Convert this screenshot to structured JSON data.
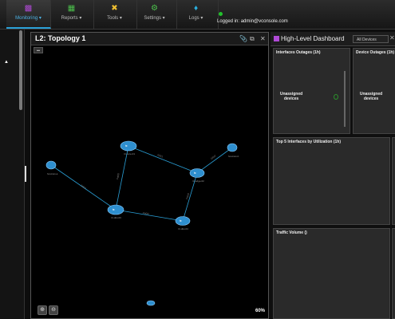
{
  "nav": {
    "items": [
      {
        "label": "Monitoring ▾",
        "icon": "monitoring-icon"
      },
      {
        "label": "Reports ▾",
        "icon": "reports-icon"
      },
      {
        "label": "Tools ▾",
        "icon": "tools-icon"
      },
      {
        "label": "Settings ▾",
        "icon": "settings-icon"
      },
      {
        "label": "Logs ▾",
        "icon": "logs-icon"
      }
    ],
    "login_text": "Logged in: admin@vconsole.com",
    "status_color": "#22c22c"
  },
  "topology": {
    "title": "L2: Topology 1",
    "zoom": "60%",
    "link_color": "#2a9fd6",
    "node_color": "#2e8fcf"
  },
  "dashboard": {
    "title": "High-Level Dashboard",
    "filter": "All Devices",
    "widgets": {
      "interfaces_outages": {
        "title": "Interfaces Outages (1h)",
        "label": "Unassigned devices"
      },
      "device_outages": {
        "title": "Device Outages (1h)",
        "label": "Unassigned devices"
      },
      "top5": {
        "title": "Top 5 Interfaces by Utilization (1h)"
      },
      "traffic": {
        "title": "Traffic Volume ()"
      }
    }
  }
}
